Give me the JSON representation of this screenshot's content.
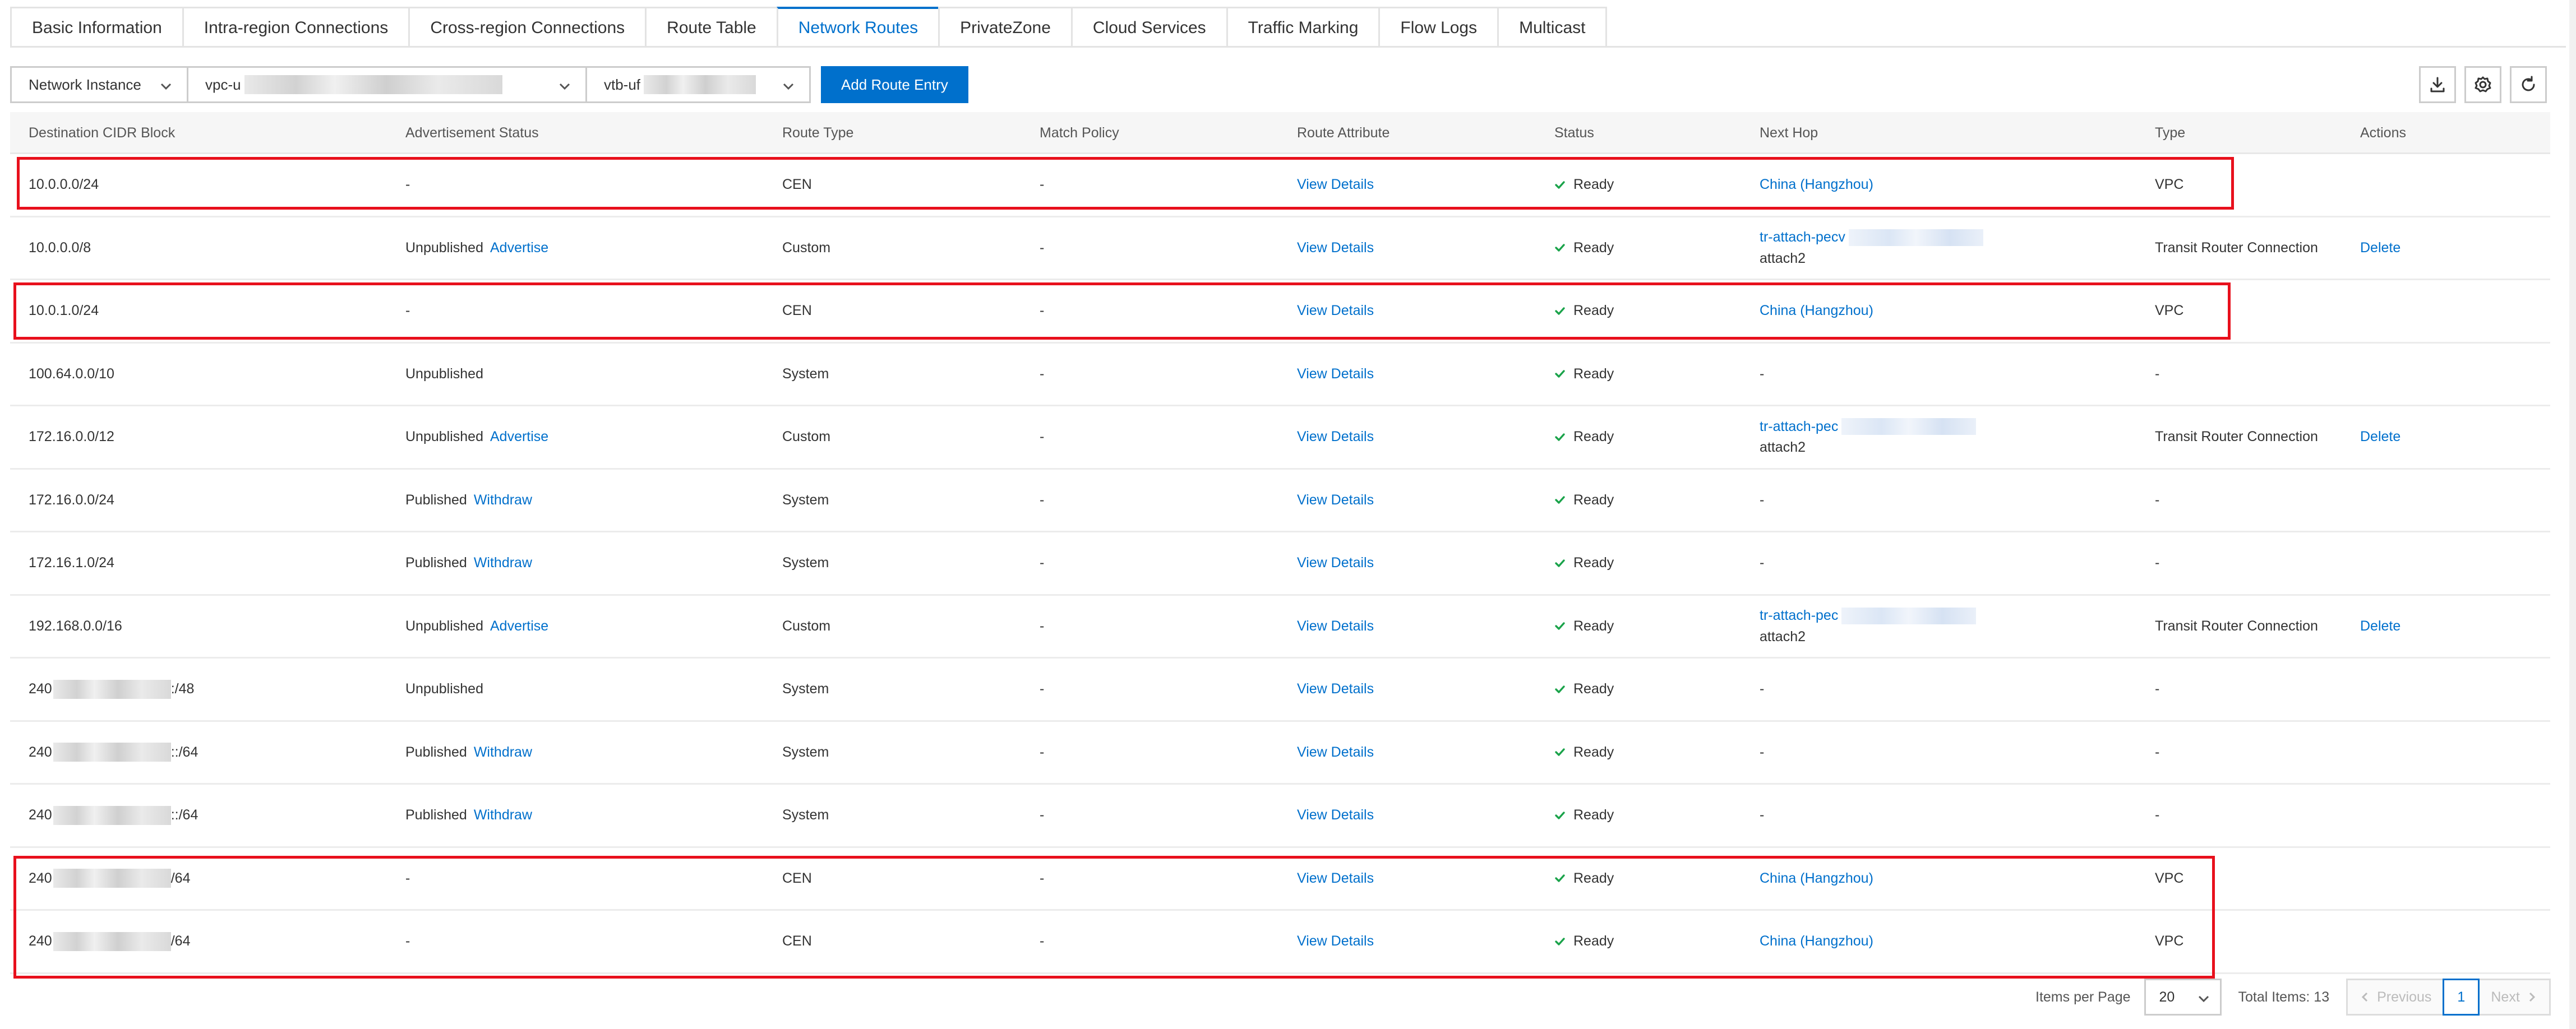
{
  "tabs": [
    {
      "label": "Basic Information",
      "active": false
    },
    {
      "label": "Intra-region Connections",
      "active": false
    },
    {
      "label": "Cross-region Connections",
      "active": false
    },
    {
      "label": "Route Table",
      "active": false
    },
    {
      "label": "Network Routes",
      "active": true
    },
    {
      "label": "PrivateZone",
      "active": false
    },
    {
      "label": "Cloud Services",
      "active": false
    },
    {
      "label": "Traffic Marking",
      "active": false
    },
    {
      "label": "Flow Logs",
      "active": false
    },
    {
      "label": "Multicast",
      "active": false
    }
  ],
  "toolbar": {
    "instance_type_select": "Network Instance",
    "vpc_select_prefix": "vpc-u",
    "vtb_select_prefix": "vtb-uf",
    "add_button": "Add Route Entry",
    "icons": [
      "download-icon",
      "settings-icon",
      "refresh-icon"
    ]
  },
  "table": {
    "columns": [
      "Destination CIDR Block",
      "Advertisement Status",
      "Route Type",
      "Match Policy",
      "Route Attribute",
      "Status",
      "Next Hop",
      "Type",
      "Actions"
    ],
    "rows": [
      {
        "cidr": "10.0.0.0/24",
        "ad_status": "-",
        "ad_action": "",
        "route_type": "CEN",
        "match_policy": "-",
        "attr": "View Details",
        "status": "Ready",
        "next_hop": "China (Hangzhou)",
        "next_hop_line2": "",
        "next_hop_link": true,
        "type": "VPC",
        "action": ""
      },
      {
        "cidr": "10.0.0.0/8",
        "ad_status": "Unpublished",
        "ad_action": "Advertise",
        "route_type": "Custom",
        "match_policy": "-",
        "attr": "View Details",
        "status": "Ready",
        "next_hop": "tr-attach-pecv",
        "next_hop_line2": "attach2",
        "next_hop_link": true,
        "type": "Transit Router Connection",
        "action": "Delete"
      },
      {
        "cidr": "10.0.1.0/24",
        "ad_status": "-",
        "ad_action": "",
        "route_type": "CEN",
        "match_policy": "-",
        "attr": "View Details",
        "status": "Ready",
        "next_hop": "China (Hangzhou)",
        "next_hop_line2": "",
        "next_hop_link": true,
        "type": "VPC",
        "action": ""
      },
      {
        "cidr": "100.64.0.0/10",
        "ad_status": "Unpublished",
        "ad_action": "",
        "route_type": "System",
        "match_policy": "-",
        "attr": "View Details",
        "status": "Ready",
        "next_hop": "-",
        "next_hop_line2": "",
        "next_hop_link": false,
        "type": "-",
        "action": ""
      },
      {
        "cidr": "172.16.0.0/12",
        "ad_status": "Unpublished",
        "ad_action": "Advertise",
        "route_type": "Custom",
        "match_policy": "-",
        "attr": "View Details",
        "status": "Ready",
        "next_hop": "tr-attach-pec",
        "next_hop_line2": "attach2",
        "next_hop_link": true,
        "type": "Transit Router Connection",
        "action": "Delete"
      },
      {
        "cidr": "172.16.0.0/24",
        "ad_status": "Published",
        "ad_action": "Withdraw",
        "route_type": "System",
        "match_policy": "-",
        "attr": "View Details",
        "status": "Ready",
        "next_hop": "-",
        "next_hop_line2": "",
        "next_hop_link": false,
        "type": "-",
        "action": ""
      },
      {
        "cidr": "172.16.1.0/24",
        "ad_status": "Published",
        "ad_action": "Withdraw",
        "route_type": "System",
        "match_policy": "-",
        "attr": "View Details",
        "status": "Ready",
        "next_hop": "-",
        "next_hop_line2": "",
        "next_hop_link": false,
        "type": "-",
        "action": ""
      },
      {
        "cidr": "192.168.0.0/16",
        "ad_status": "Unpublished",
        "ad_action": "Advertise",
        "route_type": "Custom",
        "match_policy": "-",
        "attr": "View Details",
        "status": "Ready",
        "next_hop": "tr-attach-pec",
        "next_hop_line2": "attach2",
        "next_hop_link": true,
        "type": "Transit Router Connection",
        "action": "Delete"
      },
      {
        "cidr": "240",
        "cidr_suffix": ":/48",
        "ad_status": "Unpublished",
        "ad_action": "",
        "route_type": "System",
        "match_policy": "-",
        "attr": "View Details",
        "status": "Ready",
        "next_hop": "-",
        "next_hop_line2": "",
        "next_hop_link": false,
        "type": "-",
        "action": ""
      },
      {
        "cidr": "240",
        "cidr_suffix": "::/64",
        "ad_status": "Published",
        "ad_action": "Withdraw",
        "route_type": "System",
        "match_policy": "-",
        "attr": "View Details",
        "status": "Ready",
        "next_hop": "-",
        "next_hop_line2": "",
        "next_hop_link": false,
        "type": "-",
        "action": ""
      },
      {
        "cidr": "240",
        "cidr_suffix": "::/64",
        "ad_status": "Published",
        "ad_action": "Withdraw",
        "route_type": "System",
        "match_policy": "-",
        "attr": "View Details",
        "status": "Ready",
        "next_hop": "-",
        "next_hop_line2": "",
        "next_hop_link": false,
        "type": "-",
        "action": ""
      },
      {
        "cidr": "240",
        "cidr_suffix": "/64",
        "ad_status": "-",
        "ad_action": "",
        "route_type": "CEN",
        "match_policy": "-",
        "attr": "View Details",
        "status": "Ready",
        "next_hop": "China (Hangzhou)",
        "next_hop_line2": "",
        "next_hop_link": true,
        "type": "VPC",
        "action": ""
      },
      {
        "cidr": "240",
        "cidr_suffix": "/64",
        "ad_status": "-",
        "ad_action": "",
        "route_type": "CEN",
        "match_policy": "-",
        "attr": "View Details",
        "status": "Ready",
        "next_hop": "China (Hangzhou)",
        "next_hop_line2": "",
        "next_hop_link": true,
        "type": "VPC",
        "action": ""
      }
    ]
  },
  "pagination": {
    "items_per_page_label": "Items per Page",
    "page_size": "20",
    "total": "Total Items: 13",
    "prev": "Previous",
    "current": "1",
    "next": "Next"
  },
  "colors": {
    "accent": "#0070cc",
    "success": "#1aa34a",
    "highlight": "#e8101c"
  }
}
